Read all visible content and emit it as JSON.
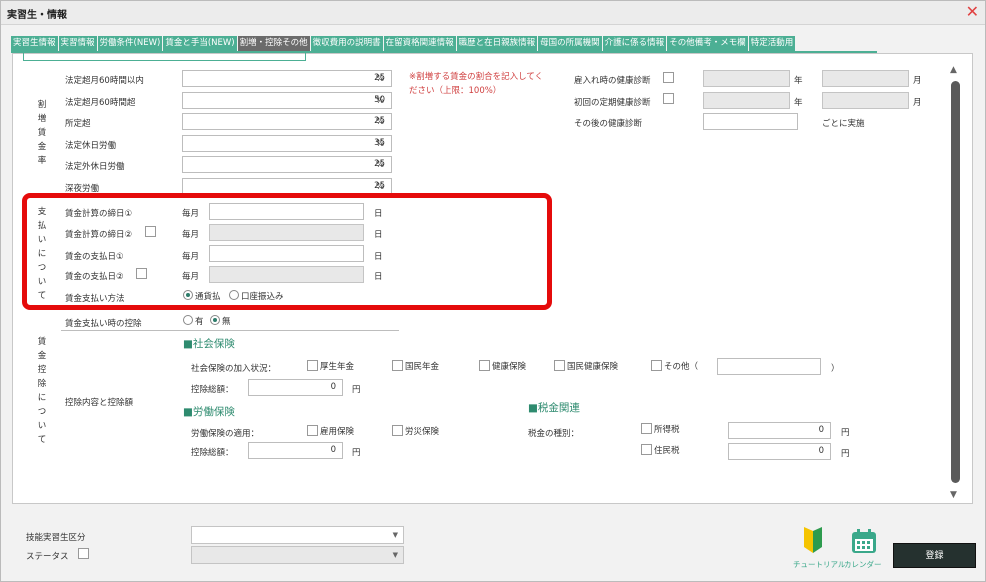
{
  "window": {
    "title": "実習生・情報",
    "close": "✕"
  },
  "tabs": [
    "実習生情報",
    "実習情報",
    "労働条件(NEW)",
    "賃金と手当(NEW)",
    "割増・控除その他",
    "徴収費用の説明書",
    "在留資格関連情報",
    "職歴と在日親族情報",
    "母国の所属機関",
    "介護に係る情報",
    "その他備考・メモ欄",
    "特定活動用"
  ],
  "premium": {
    "section_label": "割増賃金率",
    "rows": [
      {
        "label": "法定超月60時間以内",
        "value": "25",
        "unit": "%"
      },
      {
        "label": "法定超月60時間超",
        "value": "50",
        "unit": "%"
      },
      {
        "label": "所定超",
        "value": "25",
        "unit": "%"
      },
      {
        "label": "法定休日労働",
        "value": "35",
        "unit": "%"
      },
      {
        "label": "法定外休日労働",
        "value": "25",
        "unit": "%"
      },
      {
        "label": "深夜労働",
        "value": "25",
        "unit": "%"
      }
    ],
    "note": "※割増する賃金の割合を記入してください（上限：100%）"
  },
  "health": {
    "rows": [
      {
        "label": "雇入れ時の健康診断",
        "unit1": "年",
        "unit2": "月"
      },
      {
        "label": "初回の定期健康診断",
        "unit1": "年",
        "unit2": "月"
      },
      {
        "label": "その後の健康診断",
        "suffix": "ごとに実施"
      }
    ]
  },
  "payment": {
    "section_label": "支払いについて",
    "rows": [
      {
        "label": "賃金計算の締日①",
        "prefix": "毎月",
        "value": "",
        "unit": "日"
      },
      {
        "label": "賃金計算の締日②",
        "prefix": "毎月",
        "value": "",
        "unit": "日"
      },
      {
        "label": "賃金の支払日①",
        "prefix": "毎月",
        "value": "",
        "unit": "日"
      },
      {
        "label": "賃金の支払日②",
        "prefix": "毎月",
        "value": "",
        "unit": "日"
      }
    ],
    "method_label": "賃金支払い方法",
    "method_options": [
      "通貨払",
      "口座振込み"
    ]
  },
  "deduction": {
    "section_label": "賃金控除について",
    "withhold_label": "賃金支払い時の控除",
    "withhold_options": [
      "有",
      "無"
    ],
    "detail_label": "控除内容と控除額",
    "social": {
      "title": "■社会保険",
      "join_label": "社会保険の加入状況：",
      "options": [
        "厚生年金",
        "国民年金",
        "健康保険",
        "国民健康保険",
        "その他（"
      ],
      "close_paren": "）",
      "total_label": "控除総額：",
      "total_value": "0",
      "yen": "円"
    },
    "labor": {
      "title": "■労働保険",
      "apply_label": "労働保険の適用：",
      "options": [
        "雇用保険",
        "労災保険"
      ],
      "total_label": "控除総額：",
      "total_value": "0",
      "yen": "円"
    },
    "tax": {
      "title": "■税金関連",
      "type_label": "税金の種別：",
      "options": [
        "所得税",
        "住民税"
      ],
      "values": [
        "0",
        "0"
      ],
      "yen": "円"
    }
  },
  "footer": {
    "skill_label": "技能実習生区分",
    "status_label": "ステータス",
    "tutorial": "チュートリアル",
    "calendar": "カレンダー",
    "register": "登録"
  }
}
